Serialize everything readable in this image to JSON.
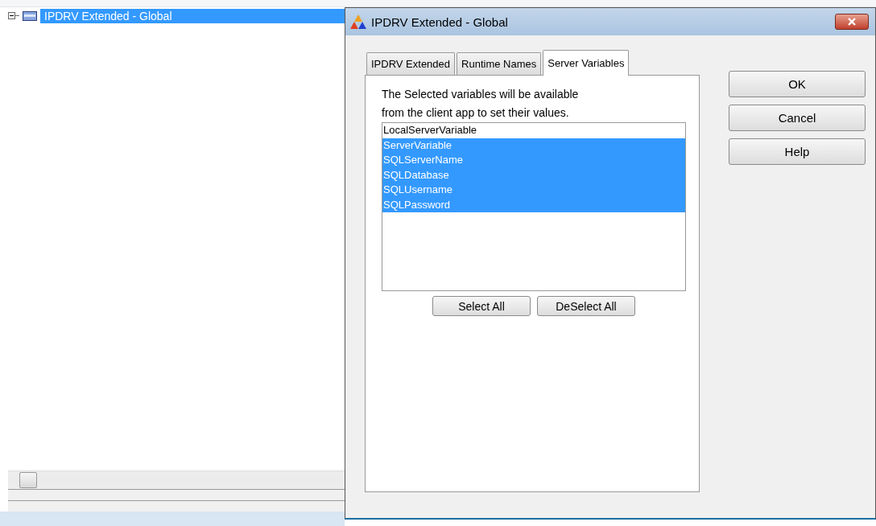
{
  "tree": {
    "items": [
      {
        "label": "IPDRV Extended - Global",
        "selected": true,
        "expanded": true
      }
    ]
  },
  "dialog": {
    "title": "IPDRV Extended - Global",
    "tabs": [
      {
        "label": "IPDRV Extended",
        "selected": false
      },
      {
        "label": "Runtime Names",
        "selected": false
      },
      {
        "label": "Server Variables",
        "selected": true
      }
    ],
    "description": [
      "The Selected variables will be available",
      "from the client app to set their values."
    ],
    "variables": [
      {
        "label": "LocalServerVariable",
        "selected": false
      },
      {
        "label": "ServerVariable",
        "selected": true
      },
      {
        "label": "SQLServerName",
        "selected": true
      },
      {
        "label": "SQLDatabase",
        "selected": true
      },
      {
        "label": "SQLUsername",
        "selected": true
      },
      {
        "label": "SQLPassword",
        "selected": true
      }
    ],
    "list_buttons": [
      "Select All",
      "DeSelect All"
    ],
    "buttons": [
      "OK",
      "Cancel",
      "Help"
    ]
  }
}
